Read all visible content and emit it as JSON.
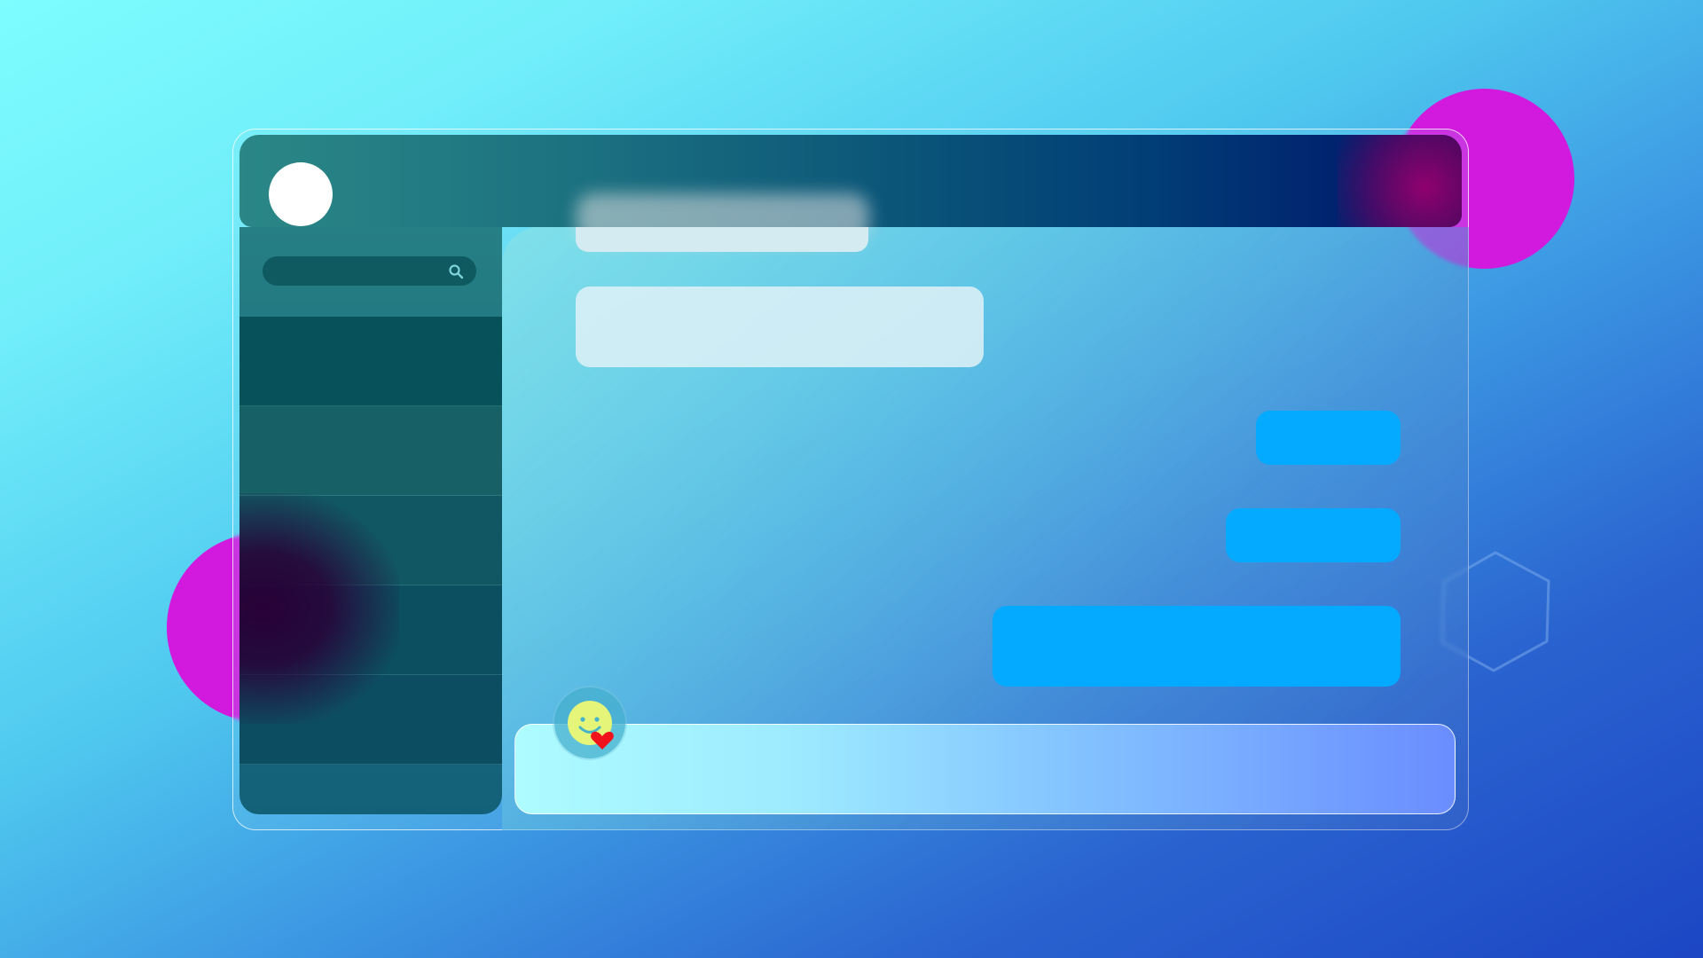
{
  "theme": {
    "accent": "#03aaff",
    "blob_color": "#d21ade",
    "background_start": "#7dfdfe",
    "background_end": "#1c46c4"
  },
  "header": {
    "avatar_icon": "user-avatar",
    "contact_name": ""
  },
  "sidebar": {
    "search": {
      "value": "",
      "placeholder": "",
      "icon": "search-icon"
    },
    "contacts": [
      {
        "name": ""
      },
      {
        "name": ""
      },
      {
        "name": ""
      },
      {
        "name": ""
      },
      {
        "name": ""
      }
    ]
  },
  "chat": {
    "messages": [
      {
        "direction": "incoming",
        "text": ""
      },
      {
        "direction": "incoming",
        "text": ""
      },
      {
        "direction": "outgoing",
        "text": ""
      },
      {
        "direction": "outgoing",
        "text": ""
      },
      {
        "direction": "outgoing",
        "text": ""
      }
    ]
  },
  "composer": {
    "value": "",
    "placeholder": "",
    "emoji_icon": "smiley-heart-icon"
  },
  "decorations": {
    "shapes": [
      "circle-blob",
      "circle-blob",
      "hexagon-outline"
    ]
  }
}
